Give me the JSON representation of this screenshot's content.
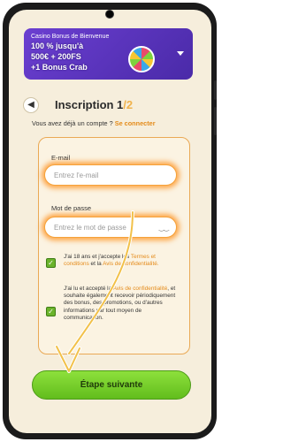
{
  "banner": {
    "small_text": "Casino Bonus de Bienvenue",
    "line1": "100 % jusqu'à",
    "line2": "500€ + 200FS",
    "line3": "+1 Bonus Crab",
    "expand_icon": "chevron-down-icon"
  },
  "header": {
    "back_icon": "chevron-left-icon",
    "title": "Inscription 1",
    "step_total": "/2",
    "subtitle": "Vous avez déjà un compte ?",
    "login_link": "Se connecter"
  },
  "form": {
    "email_label": "E-mail",
    "email_placeholder": "Entrez l'e-mail",
    "password_label": "Mot de passe",
    "password_placeholder": "Entrez le mot de passe",
    "password_toggle_icon": "eye-closed-icon",
    "terms_text_1": "J'ai 18 ans et j'accepte les",
    "terms_link_1": "Termes et conditions",
    "terms_text_2": " et la",
    "terms_link_2": "Avis de confidentialité.",
    "marketing_text_1": "J'ai lu et accepté la",
    "marketing_link": "Avis de confidentialité",
    "marketing_text_2": ", et souhaite également recevoir périodiquement des bonus, des promotions, ou d'autres informations par tout moyen de communication.",
    "terms_checked": true,
    "marketing_checked": true
  },
  "button": {
    "next_label": "Étape suivante"
  },
  "colors": {
    "accent": "#f0b24b",
    "link": "#e48b1a",
    "button": "#6fc727",
    "banner": "#5a33c0",
    "highlight": "#ff8c14"
  }
}
